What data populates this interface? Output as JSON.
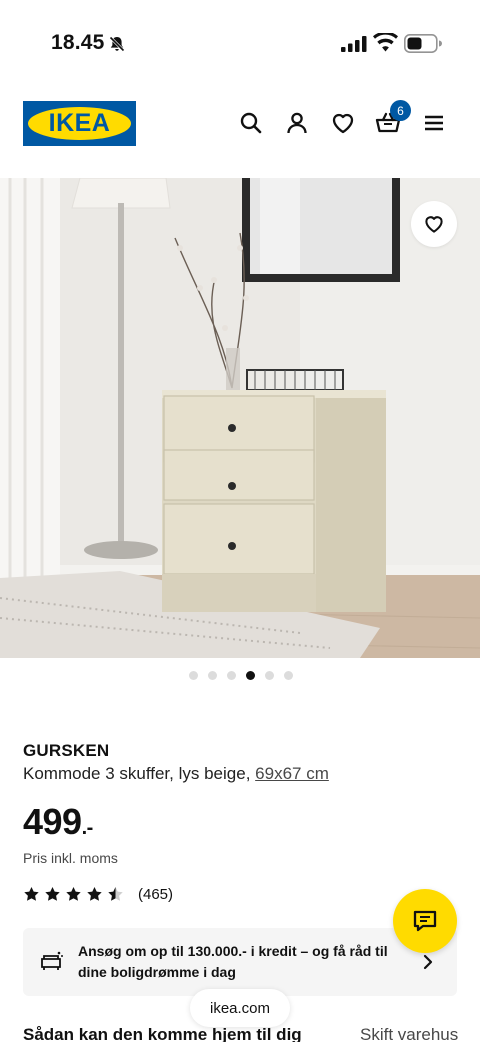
{
  "status_bar": {
    "time": "18.45"
  },
  "header": {
    "logo_text": "IKEA",
    "cart_count": "6",
    "icons": [
      "search-icon",
      "user-icon",
      "heart-icon",
      "cart-icon",
      "menu-icon"
    ]
  },
  "gallery": {
    "image_count": 6,
    "active_index": 3
  },
  "product": {
    "name": "GURSKEN",
    "description": "Kommode 3 skuffer, lys beige,",
    "measure": "69x67 cm",
    "price": "499",
    "price_suffix": ".-",
    "vat_note": "Pris inkl. moms",
    "rating": 4.5,
    "rating_count": "(465)"
  },
  "credit_banner": {
    "text": "Ansøg om op til 130.000.- i kredit – og få råd til dine boligdrømme i dag"
  },
  "browser": {
    "url": "ikea.com"
  },
  "delivery": {
    "title": "Sådan kan den komme hjem til dig",
    "change_store": "Skift varehus"
  },
  "colors": {
    "brand_blue": "#0058a3",
    "brand_yellow": "#ffdb00"
  }
}
